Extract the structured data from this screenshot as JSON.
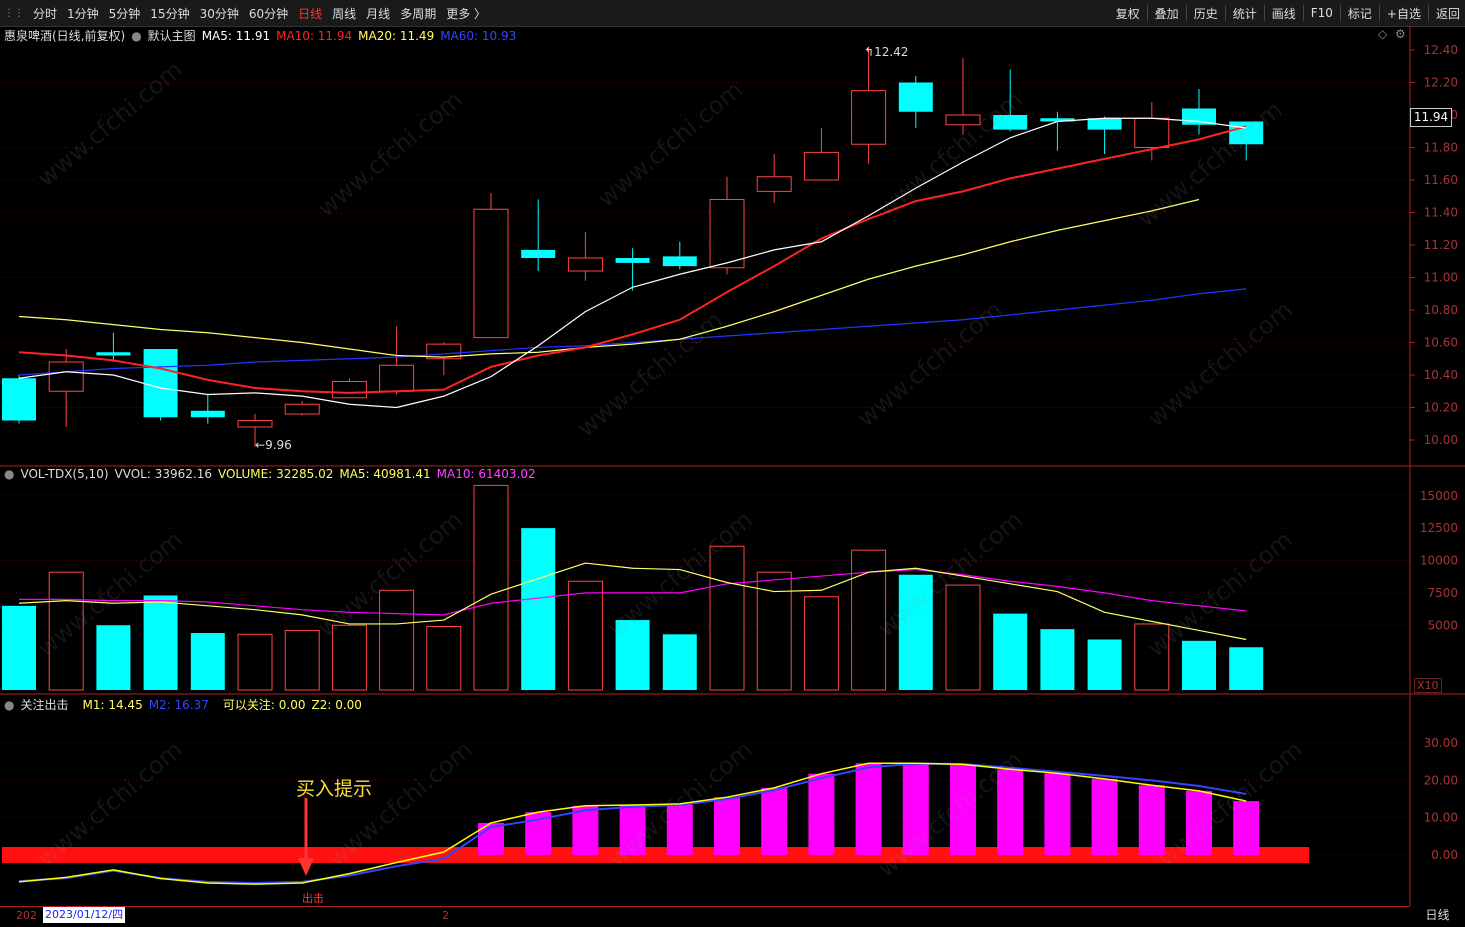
{
  "toolbar": {
    "left_items": [
      "分时",
      "1分钟",
      "5分钟",
      "15分钟",
      "30分钟",
      "60分钟",
      "日线",
      "周线",
      "月线",
      "多周期",
      "更多 〉"
    ],
    "active": "日线",
    "right_items": [
      "复权",
      "叠加",
      "历史",
      "统计",
      "画线",
      "F10",
      "标记",
      "+自选",
      "返回"
    ]
  },
  "main_panel": {
    "stock_title": "惠泉啤酒(日线,前复权)",
    "template": "默认主图",
    "ma5": "MA5: 11.91",
    "ma10": "MA10: 11.94",
    "ma20": "MA20: 11.49",
    "ma60": "MA60: 10.93",
    "current_price": "11.94",
    "high_annotation": "12.42",
    "low_annotation": "9.96",
    "price_ticks": [
      "12.40",
      "12.20",
      "12.00",
      "11.80",
      "11.60",
      "11.40",
      "11.20",
      "11.00",
      "10.80",
      "10.60",
      "10.40",
      "10.20",
      "10.00"
    ]
  },
  "volume_panel": {
    "indicator": "VOL-TDX(5,10)",
    "vvol": "VVOL: 33962.16",
    "volume": "VOLUME: 32285.02",
    "ma5": "MA5: 40981.41",
    "ma10": "MA10: 61403.02",
    "ticks": [
      "15000",
      "12500",
      "10000",
      "7500",
      "5000"
    ],
    "unit": "X10"
  },
  "indicator_panel": {
    "name": "关注出击",
    "m1": "M1: 14.45",
    "m2": "M2: 16.37",
    "focus": "可以关注: 0.00",
    "z2": "Z2: 0.00",
    "ticks": [
      "30.00",
      "20.00",
      "10.00",
      "0.00"
    ],
    "buy_hint": "买入提示",
    "exit_label": "出击"
  },
  "date_bar": {
    "prefix": "202",
    "cursor_date": "2023/01/12/四",
    "tick": "2"
  },
  "period_tab": "日线",
  "watermark": "www.cfchi.com",
  "colors": {
    "up": "#ff4444",
    "down": "#00ffff",
    "ma5": "#ffffff",
    "ma10": "#ff2222",
    "ma20": "#ffff66",
    "ma60": "#2233ff",
    "magenta": "#ff00ff",
    "yellow": "#ffff00",
    "blue": "#3344ff"
  },
  "chart_data": {
    "type": "candlestick",
    "candles": [
      {
        "o": 10.38,
        "h": 10.4,
        "l": 10.1,
        "c": 10.12
      },
      {
        "o": 10.3,
        "h": 10.56,
        "l": 10.08,
        "c": 10.48
      },
      {
        "o": 10.54,
        "h": 10.66,
        "l": 10.48,
        "c": 10.52
      },
      {
        "o": 10.56,
        "h": 10.56,
        "l": 10.12,
        "c": 10.14
      },
      {
        "o": 10.18,
        "h": 10.28,
        "l": 10.1,
        "c": 10.14
      },
      {
        "o": 10.08,
        "h": 10.16,
        "l": 9.96,
        "c": 10.12
      },
      {
        "o": 10.16,
        "h": 10.24,
        "l": 10.15,
        "c": 10.22
      },
      {
        "o": 10.26,
        "h": 10.38,
        "l": 10.26,
        "c": 10.36
      },
      {
        "o": 10.3,
        "h": 10.7,
        "l": 10.28,
        "c": 10.46
      },
      {
        "o": 10.5,
        "h": 10.6,
        "l": 10.4,
        "c": 10.59
      },
      {
        "o": 10.63,
        "h": 11.52,
        "l": 10.63,
        "c": 11.42
      },
      {
        "o": 11.17,
        "h": 11.48,
        "l": 11.04,
        "c": 11.12
      },
      {
        "o": 11.04,
        "h": 11.28,
        "l": 10.98,
        "c": 11.12
      },
      {
        "o": 11.12,
        "h": 11.18,
        "l": 10.92,
        "c": 11.09
      },
      {
        "o": 11.13,
        "h": 11.22,
        "l": 11.05,
        "c": 11.07
      },
      {
        "o": 11.06,
        "h": 11.62,
        "l": 11.02,
        "c": 11.48
      },
      {
        "o": 11.53,
        "h": 11.76,
        "l": 11.46,
        "c": 11.62
      },
      {
        "o": 11.6,
        "h": 11.92,
        "l": 11.6,
        "c": 11.77
      },
      {
        "o": 11.82,
        "h": 12.42,
        "l": 11.7,
        "c": 12.15
      },
      {
        "o": 12.2,
        "h": 12.24,
        "l": 11.92,
        "c": 12.02
      },
      {
        "o": 11.94,
        "h": 12.35,
        "l": 11.88,
        "c": 12.0
      },
      {
        "o": 12.0,
        "h": 12.28,
        "l": 11.9,
        "c": 11.91
      },
      {
        "o": 11.98,
        "h": 12.02,
        "l": 11.78,
        "c": 11.96
      },
      {
        "o": 11.98,
        "h": 11.99,
        "l": 11.76,
        "c": 11.91
      },
      {
        "o": 11.8,
        "h": 12.08,
        "l": 11.72,
        "c": 11.98
      },
      {
        "o": 12.04,
        "h": 12.16,
        "l": 11.88,
        "c": 11.94
      },
      {
        "o": 11.96,
        "h": 11.96,
        "l": 11.72,
        "c": 11.82
      }
    ],
    "ma5": [
      10.38,
      10.42,
      10.4,
      10.32,
      10.28,
      10.29,
      10.27,
      10.22,
      10.2,
      10.27,
      10.39,
      10.58,
      10.79,
      10.94,
      11.02,
      11.09,
      11.17,
      11.22,
      11.38,
      11.55,
      11.71,
      11.86,
      11.96,
      11.98,
      11.98,
      11.96,
      11.92
    ],
    "ma10": [
      10.54,
      10.52,
      10.49,
      10.44,
      10.37,
      10.32,
      10.3,
      10.29,
      10.3,
      10.31,
      10.45,
      10.52,
      10.57,
      10.65,
      10.74,
      10.91,
      11.07,
      11.24,
      11.36,
      11.47,
      11.53,
      11.61,
      11.67,
      11.73,
      11.79,
      11.85,
      11.93
    ],
    "ma20": [
      10.76,
      10.74,
      10.71,
      10.68,
      10.66,
      10.63,
      10.6,
      10.56,
      10.52,
      10.51,
      10.53,
      10.54,
      10.57,
      10.59,
      10.62,
      10.7,
      10.79,
      10.89,
      10.99,
      11.07,
      11.14,
      11.22,
      11.29,
      11.35,
      11.41,
      11.48
    ],
    "ma60": [
      10.4,
      10.42,
      10.44,
      10.45,
      10.46,
      10.48,
      10.49,
      10.5,
      10.51,
      10.53,
      10.55,
      10.57,
      10.58,
      10.6,
      10.62,
      10.64,
      10.66,
      10.68,
      10.7,
      10.72,
      10.74,
      10.77,
      10.8,
      10.83,
      10.86,
      10.9,
      10.93
    ],
    "volume": [
      6500,
      9100,
      5000,
      7300,
      4400,
      4300,
      4600,
      5000,
      7700,
      4900,
      15800,
      12500,
      8400,
      5400,
      4300,
      11100,
      9100,
      7200,
      10800,
      8900,
      8100,
      5900,
      4700,
      3900,
      5100,
      3800,
      3300
    ],
    "vol_ma5": [
      6700,
      6900,
      6700,
      6800,
      6500,
      6200,
      5800,
      5100,
      5100,
      5400,
      7400,
      8600,
      9800,
      9400,
      9300,
      8300,
      7600,
      7700,
      9100,
      9400,
      8800,
      8200,
      7600,
      6000,
      5300,
      4600,
      3900
    ],
    "vol_ma10": [
      7000,
      7000,
      6900,
      6900,
      6800,
      6500,
      6200,
      6000,
      5900,
      5800,
      6700,
      7100,
      7500,
      7500,
      7500,
      8200,
      8500,
      8800,
      9100,
      9300,
      8900,
      8400,
      8000,
      7500,
      6900,
      6500,
      6100
    ],
    "m1": [
      -7.2,
      -6.0,
      -4.0,
      -6.3,
      -7.5,
      -7.8,
      -7.5,
      -5.0,
      -2.0,
      0.8,
      8.6,
      11.5,
      13.2,
      13.4,
      13.7,
      15.5,
      18.0,
      21.8,
      24.6,
      24.6,
      24.3,
      23.0,
      21.9,
      20.4,
      18.7,
      17.2,
      14.45
    ],
    "m2": [
      -7.0,
      -6.2,
      -4.2,
      -6.2,
      -7.2,
      -7.5,
      -7.2,
      -5.5,
      -3.0,
      -1.0,
      7.5,
      9.5,
      12.0,
      12.9,
      13.4,
      15.0,
      17.4,
      20.6,
      23.5,
      24.5,
      24.4,
      23.4,
      22.3,
      21.2,
      20.0,
      18.5,
      16.37
    ],
    "ind_bars": [
      null,
      null,
      null,
      null,
      null,
      null,
      null,
      null,
      null,
      null,
      8.6,
      11.5,
      13.2,
      13.4,
      13.7,
      15.5,
      18.0,
      21.8,
      24.6,
      24.6,
      24.3,
      23.0,
      21.9,
      20.4,
      18.7,
      17.2,
      14.45
    ]
  }
}
